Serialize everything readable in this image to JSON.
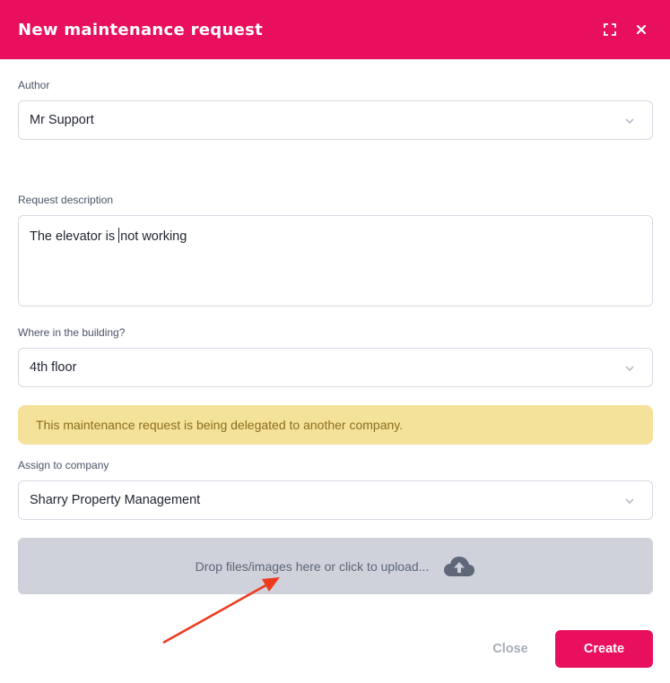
{
  "modal": {
    "title": "New maintenance request",
    "expand_icon": "expand-icon",
    "close_icon": "close-icon",
    "accent_color": "#e8105e"
  },
  "form": {
    "author": {
      "label": "Author",
      "value": "Mr Support"
    },
    "description": {
      "label": "Request description",
      "value_before_caret": "The elevator is ",
      "value_after_caret": "not working"
    },
    "location": {
      "label": "Where in the building?",
      "value": "4th floor"
    },
    "notice": "This maintenance request is being delegated to another company.",
    "company": {
      "label": "Assign to company",
      "value": "Sharry Property Management"
    },
    "upload": {
      "text": "Drop files/images here or click to upload...",
      "icon": "cloud-upload-icon"
    }
  },
  "footer": {
    "close_label": "Close",
    "create_label": "Create"
  },
  "annotation": {
    "icon": "red-arrow",
    "color": "#ee3a1e"
  }
}
